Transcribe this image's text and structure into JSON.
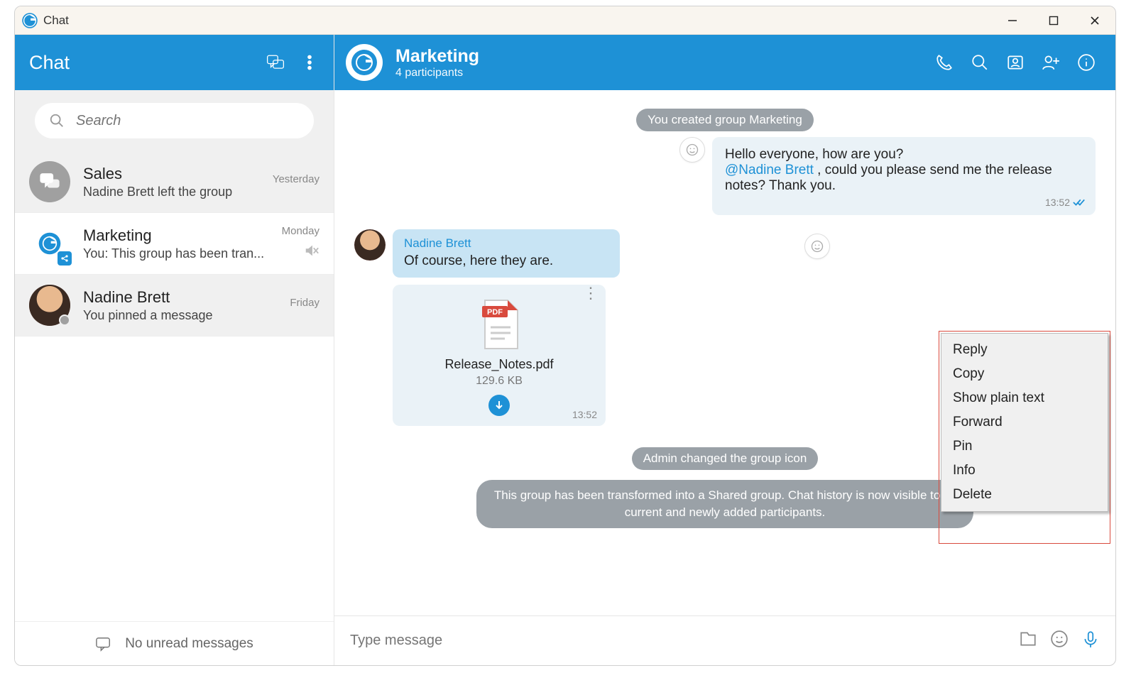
{
  "titlebar": {
    "title": "Chat"
  },
  "sidebar": {
    "title": "Chat",
    "search_placeholder": "Search",
    "footer": "No unread messages",
    "items": [
      {
        "name": "Sales",
        "preview": "Nadine Brett left the group",
        "time": "Yesterday",
        "muted": false,
        "type": "group-generic"
      },
      {
        "name": "Marketing",
        "preview": "You: This group has been tran...",
        "time": "Monday",
        "muted": true,
        "type": "group-logo"
      },
      {
        "name": "Nadine Brett",
        "preview": "You pinned a message",
        "time": "Friday",
        "muted": false,
        "type": "person"
      }
    ]
  },
  "header": {
    "group_name": "Marketing",
    "subtitle": "4 participants"
  },
  "messages": {
    "system_created": "You created group Marketing",
    "out1_line1": "Hello everyone, how are you?",
    "out1_mention": "@Nadine Brett",
    "out1_rest": " , could you please send me the release notes? Thank you.",
    "out1_time": "13:52",
    "in1_sender": "Nadine Brett",
    "in1_text": "Of course, here they are.",
    "attachment": {
      "label": "PDF",
      "name": "Release_Notes.pdf",
      "size": "129.6 KB",
      "time": "13:52"
    },
    "system_icon": "Admin changed the group icon",
    "system_shared": "This group has been transformed into a Shared group. Chat history is now visible to all current and newly added participants."
  },
  "context_menu": {
    "items": [
      "Reply",
      "Copy",
      "Show plain text",
      "Forward",
      "Pin",
      "Info",
      "Delete"
    ]
  },
  "composer": {
    "placeholder": "Type message"
  }
}
